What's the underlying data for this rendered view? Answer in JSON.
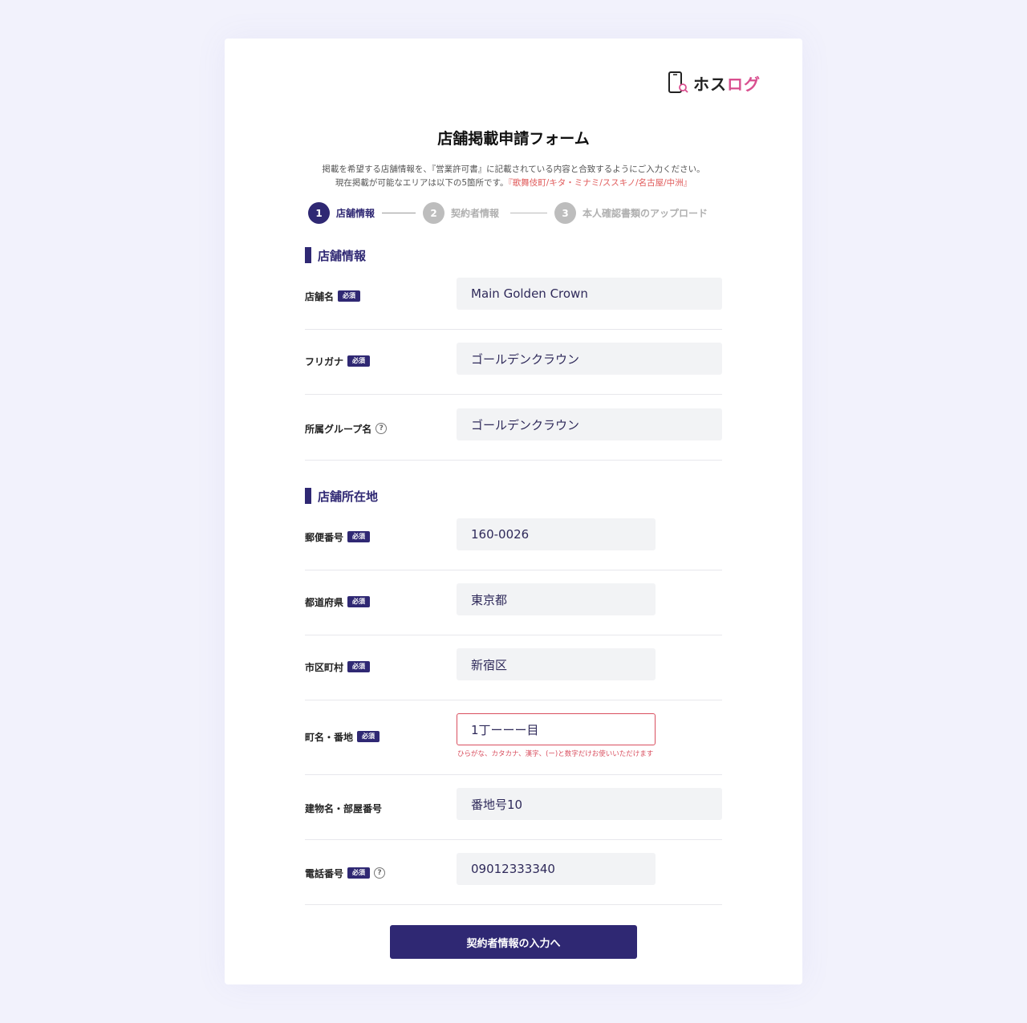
{
  "logo": {
    "text_dark": "ホス",
    "text_pink": "ログ",
    "accent": "#d94f8f"
  },
  "title": "店舗掲載申請フォーム",
  "description": {
    "line1": "掲載を希望する店舗情報を、『営業許可書』に記載されている内容と合致するようにご入力ください。",
    "line2": "現在掲載が可能なエリアは以下の5箇所です。",
    "areas": "『歌舞伎町/キタ・ミナミ/ススキノ/名古屋/中洲』"
  },
  "steps": [
    {
      "number": "1",
      "label": "店舗情報",
      "active": true
    },
    {
      "number": "2",
      "label": "契約者情報",
      "active": false
    },
    {
      "number": "3",
      "label": "本人確認書類のアップロード",
      "active": false
    }
  ],
  "sections": {
    "store_info": "店舗情報",
    "store_address": "店舗所在地"
  },
  "required_badge": "必須",
  "help_glyph": "?",
  "fields": {
    "store_name": {
      "label": "店舗名",
      "value": "Main Golden Crown"
    },
    "furigana": {
      "label": "フリガナ",
      "value": "ゴールデンクラウン"
    },
    "group_name": {
      "label": "所属グループ名",
      "value": "ゴールデンクラウン"
    },
    "postal_code": {
      "label": "郵便番号",
      "value": "160-0026"
    },
    "prefecture": {
      "label": "都道府県",
      "value": "東京都"
    },
    "city": {
      "label": "市区町村",
      "value": "新宿区"
    },
    "town": {
      "label": "町名・番地",
      "value": "1丁ーーー目",
      "error": "ひらがな、カタカナ、漢字、(ー)と数字だけお使いいただけます"
    },
    "building": {
      "label": "建物名・部屋番号",
      "value": "番地号10"
    },
    "phone": {
      "label": "電話番号",
      "value": "09012333340"
    }
  },
  "submit_label": "契約者情報の入力へ",
  "colors": {
    "primary": "#2f2873",
    "error": "#d94f5f",
    "background": "#f2f2fc"
  }
}
